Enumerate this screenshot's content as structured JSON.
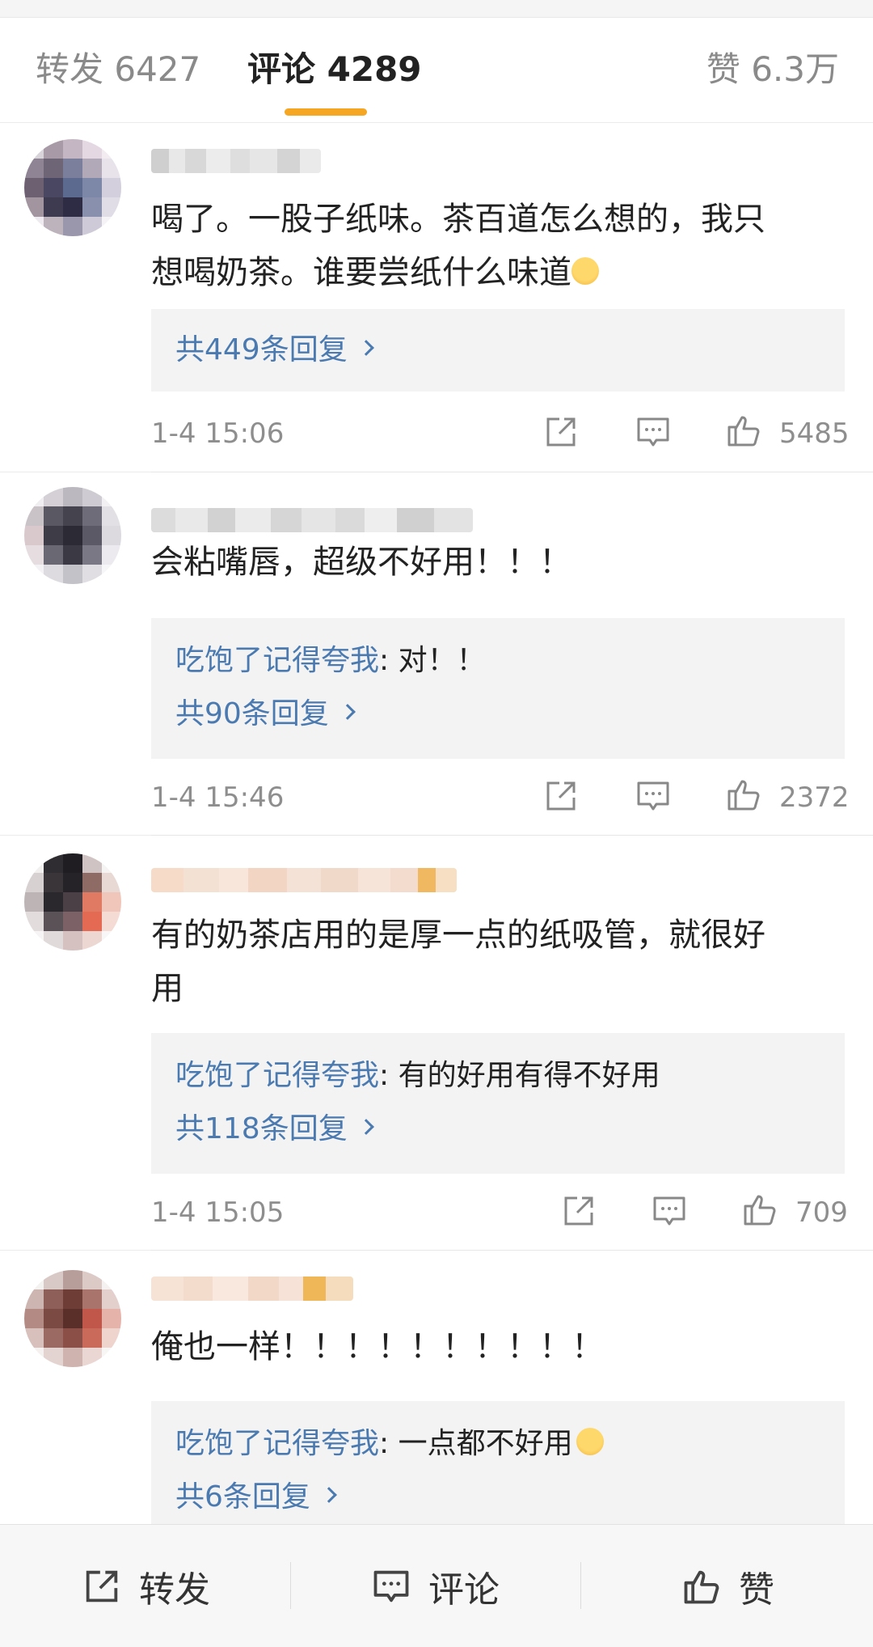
{
  "tabs": [
    {
      "label": "转发 6427"
    },
    {
      "label": "评论 4289"
    },
    {
      "label": "赞 6.3万"
    }
  ],
  "comments": [
    {
      "text_line1": "喝了。一股子纸味。茶百道怎么想的，我只",
      "text_line2": "想喝奶茶。谁要尝纸什么味道",
      "reply_user": "",
      "reply_text": "",
      "reply_count": "共449条回复",
      "time": "1-4 15:06",
      "likes": "5485"
    },
    {
      "text_line1": "会粘嘴唇，超级不好用！！！",
      "reply_user": "吃饱了记得夸我",
      "reply_text": ": 对！！",
      "reply_count": "共90条回复",
      "time": "1-4 15:46",
      "likes": "2372"
    },
    {
      "text_line1": "有的奶茶店用的是厚一点的纸吸管，就很好",
      "text_line2": "用",
      "reply_user": "吃饱了记得夸我",
      "reply_text": ": 有的好用有得不好用",
      "reply_count": "共118条回复",
      "time": "1-4 15:05",
      "likes": "709"
    },
    {
      "text_line1": "俺也一样！！！！！！！！！！",
      "reply_user": "吃饱了记得夸我",
      "reply_text": ": 一点都不好用",
      "reply_count": "共6条回复"
    }
  ],
  "bottom": {
    "repost": "转发",
    "comment": "评论",
    "like": "赞"
  },
  "colors": {
    "accent": "#f5a623",
    "link": "#4a7ab0",
    "muted": "#8e8e8e",
    "reply_bg": "#f3f3f3"
  },
  "icons": [
    "share-icon",
    "comment-icon",
    "thumbs-up-icon",
    "chevron-right-icon",
    "sweat-emoji-icon",
    "crying-emoji-icon"
  ]
}
